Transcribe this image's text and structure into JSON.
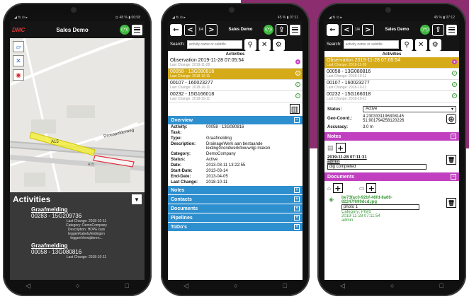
{
  "phone1": {
    "status_left": "◢ ⇅ ⊙ ▸",
    "status_right": "◷ 48 % ▮ 06:58",
    "logo": "DMC",
    "title": "Sales Demo",
    "map_road_1": "A15",
    "map_road_2": "Droespolderweg",
    "map_road_3": "A15",
    "activities_title": "Activities",
    "activities": [
      {
        "title": "Graafmelding",
        "code": "00283 - 15G209736",
        "details": [
          "Last Change: 2018-10-11",
          "Category: DemoCompany",
          "Description: HDPE buis",
          "leggenKabels/leidingen",
          "leggenVerwijderen..."
        ]
      },
      {
        "title": "Graafmelding",
        "code": "00058 - 13G080816",
        "details": [
          "Last Change: 2018-10-11"
        ]
      }
    ]
  },
  "phone2": {
    "status_left": "◢ ⇅ ⊙ ▸",
    "status_right": "45 % ▮ 07:11",
    "title": "Sales Demo",
    "zoom_label": "< 1/4 >",
    "search_label": "Search:",
    "search_placeholder": "activity name or subtitle",
    "list_head": "Activities",
    "items": [
      {
        "title": "Observation 2019-11-28 07:05:54",
        "sub": "Last Change: 2019-11-28"
      },
      {
        "title": "00058 - 13G080816",
        "sub": "Last Change: 2018-10-11"
      },
      {
        "title": "00107 - 160023277",
        "sub": "Last Change: 2018-10-11"
      },
      {
        "title": "00232 - 15G166018",
        "sub": "Last Change: 2018-10-11"
      }
    ],
    "overview_label": "Overview",
    "overview": [
      {
        "k": "Activity:",
        "v": "00058 - 13G080816"
      },
      {
        "k": "Task:",
        "v": ""
      },
      {
        "k": "Type:",
        "v": "Graafmelding"
      },
      {
        "k": "Description:",
        "v": "DrainageWerk aan bestaande leidingGrondwerk/bouwrijp maken"
      },
      {
        "k": "Category:",
        "v": "DemoCompany"
      },
      {
        "k": "Status:",
        "v": "Active"
      },
      {
        "k": "Date:",
        "v": "2013-03-11 13:22:55"
      },
      {
        "k": "Start-Date:",
        "v": "2013-03-14"
      },
      {
        "k": "End-Date:",
        "v": "2013-04-05"
      },
      {
        "k": "Last Change:",
        "v": "2018-10-11"
      }
    ],
    "sections": [
      "Notes",
      "Contacts",
      "Documents",
      "Pipelines",
      "ToDo's"
    ]
  },
  "phone3": {
    "status_left": "◢ ⇅ ⊙ ▸",
    "status_right": "45 % ▮ 07:12",
    "title": "Sales Demo",
    "search_label": "Search:",
    "search_placeholder": "activity name or subtitle",
    "list_head": "Activities",
    "items": [
      {
        "title": "Observation 2019-11-28 07:05:54",
        "sub": "Last Change: 2019-11-28"
      },
      {
        "title": "00058 - 13G080816",
        "sub": "Last Change: 2018-10-11"
      },
      {
        "title": "00107 - 160023277",
        "sub": "Last Change: 2018-10-11"
      },
      {
        "title": "00232 - 15G166018",
        "sub": "Last Change: 2018-10-11"
      }
    ],
    "status_label": "Status:",
    "status_value": "Active",
    "geo_label": "Geo-Coord.:",
    "geo_value_1": "4.2303331196308145",
    "geo_value_2": "51.901794258120226",
    "accuracy_label": "Accuracy:",
    "accuracy_value": "3.0 m",
    "notes_label": "Notes",
    "note_date": "2019-11-28 07:11:31",
    "note_user": "admin",
    "note_text": "dig completed",
    "documents_label": "Documents",
    "doc_id_1": "be73fac0-92bf-46fd-8a66-",
    "doc_id_2": "82247f699dcd.jpg",
    "doc_name": "photo 1",
    "doc_category": "Category: PIMS",
    "doc_date": "2019-11-28 07:11:54",
    "doc_user": "admin"
  }
}
